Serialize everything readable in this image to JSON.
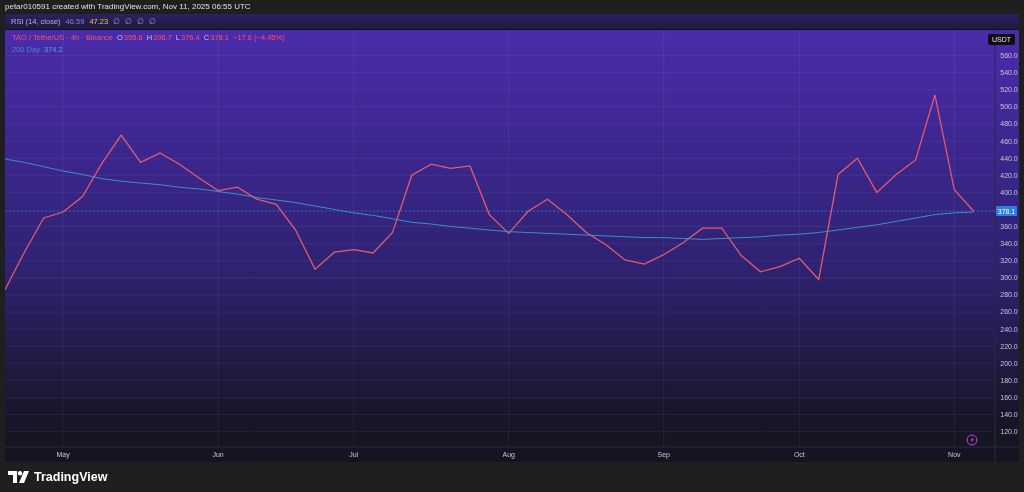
{
  "header": {
    "caption": "petar010591 created with TradingView.com, Nov 11, 2025 06:55 UTC"
  },
  "rsi_pane": {
    "title": "RSI (14, close)",
    "values": [
      {
        "text": "46.59",
        "kind": "previous"
      },
      {
        "text": "47.23",
        "kind": "current"
      },
      {
        "text": "∅",
        "kind": "empty"
      },
      {
        "text": "∅",
        "kind": "empty"
      },
      {
        "text": "∅",
        "kind": "empty"
      },
      {
        "text": "∅",
        "kind": "empty"
      }
    ]
  },
  "chart": {
    "ohlc": [
      {
        "label": "O",
        "value": "395.6"
      },
      {
        "label": "H",
        "value": "396.7"
      },
      {
        "label": "L",
        "value": "376.4"
      },
      {
        "label": "C",
        "value": "378.1"
      }
    ],
    "change": "−17.6 (−4.45%)",
    "indicator": {
      "value": "374.2"
    },
    "currency": "USDT",
    "last_price": "378.1",
    "chart_data": {
      "type": "line",
      "categories": [
        null,
        null,
        null,
        "May",
        null,
        null,
        null,
        null,
        null,
        null,
        null,
        "Jun",
        null,
        null,
        null,
        null,
        null,
        null,
        "Jul",
        null,
        null,
        null,
        null,
        null,
        null,
        null,
        "Aug",
        null,
        null,
        null,
        null,
        null,
        null,
        null,
        "Sep",
        null,
        null,
        null,
        null,
        null,
        null,
        "Oct",
        null,
        null,
        null,
        null,
        null,
        null,
        null,
        "Nov",
        null
      ],
      "series": [
        {
          "name": "TAO / TetherUS · 4h · Binance",
          "color": "#e25b6e",
          "values": [
            286,
            330,
            370,
            377,
            395,
            434,
            467,
            435,
            446,
            433,
            417,
            402,
            406,
            392,
            386,
            356,
            310,
            330,
            333,
            329,
            353,
            420,
            433,
            428,
            431,
            374,
            352,
            378,
            392,
            374,
            353,
            339,
            321,
            316,
            327,
            341,
            358,
            358,
            326,
            307,
            313,
            323,
            298,
            421,
            440,
            400,
            421,
            438,
            514,
            403,
            378
          ]
        },
        {
          "name": "200 Day",
          "color": "#3d8fc4",
          "values": [
            439,
            435,
            430,
            425,
            421,
            416,
            413,
            411,
            409,
            406,
            404,
            401,
            398,
            394,
            391,
            388,
            384,
            380,
            376,
            373,
            369,
            365,
            363,
            360,
            358,
            356,
            354,
            353,
            352,
            351,
            350,
            349,
            348,
            347,
            347,
            346,
            345,
            346,
            347,
            348,
            350,
            351,
            353,
            356,
            359,
            362,
            366,
            370,
            374,
            376,
            377
          ]
        }
      ],
      "ylim": [
        102,
        590
      ],
      "grid": true,
      "ref_lines": [
        {
          "axis": "y",
          "value": 378.1,
          "color": "#2f7de0"
        }
      ],
      "yticks": [
        {
          "value": 120,
          "label": "120.0"
        },
        {
          "value": 140,
          "label": "140.0"
        },
        {
          "value": 160,
          "label": "160.0"
        },
        {
          "value": 180,
          "label": "180.0"
        },
        {
          "value": 200,
          "label": "200.0"
        },
        {
          "value": 220,
          "label": "220.0"
        },
        {
          "value": 240,
          "label": "240.0"
        },
        {
          "value": 260,
          "label": "260.0"
        },
        {
          "value": 280,
          "label": "280.0"
        },
        {
          "value": 300,
          "label": "300.0"
        },
        {
          "value": 320,
          "label": "320.0"
        },
        {
          "value": 340,
          "label": "340.0"
        },
        {
          "value": 360,
          "label": "360.0"
        },
        {
          "value": 400,
          "label": "400.0"
        },
        {
          "value": 420,
          "label": "420.0"
        },
        {
          "value": 440,
          "label": "440.0"
        },
        {
          "value": 460,
          "label": "460.0"
        },
        {
          "value": 480,
          "label": "480.0"
        },
        {
          "value": 500,
          "label": "500.0"
        },
        {
          "value": 520,
          "label": "520.0"
        },
        {
          "value": 540,
          "label": "540.0"
        },
        {
          "value": 560,
          "label": "560.0"
        }
      ]
    }
  },
  "footer": {
    "logo": "TradingView"
  }
}
